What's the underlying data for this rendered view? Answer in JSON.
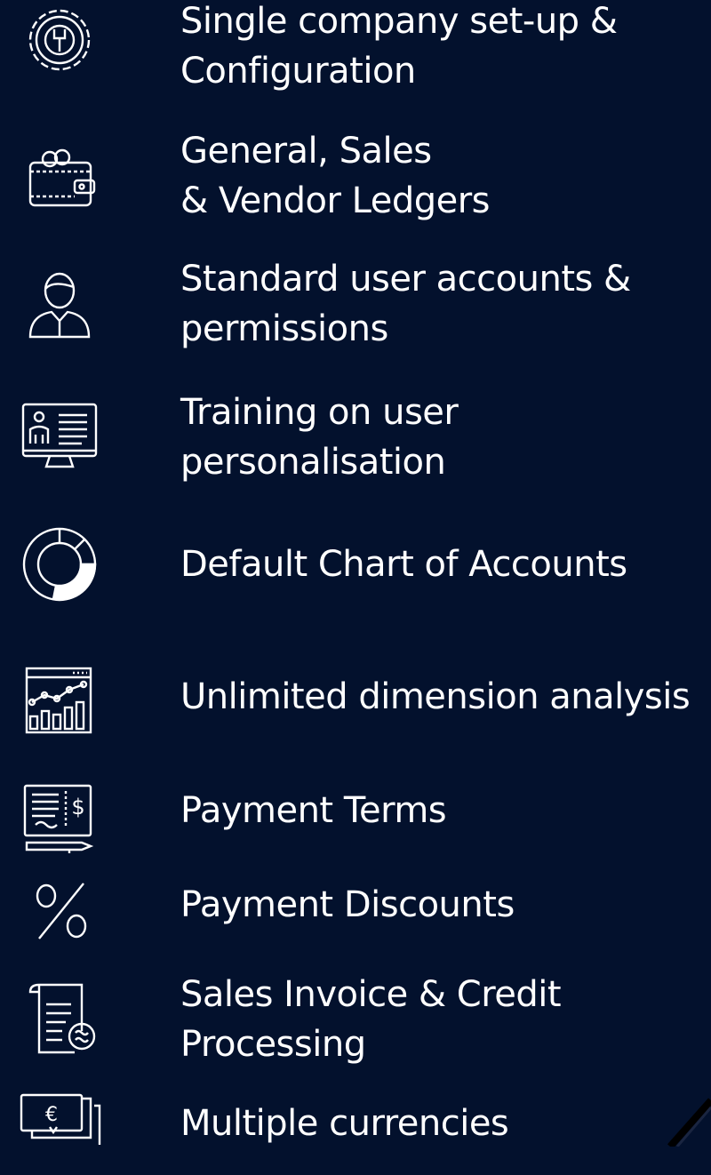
{
  "colors": {
    "background": "#03112d",
    "foreground": "#ffffff"
  },
  "features": [
    {
      "icon": "gear-wrench-icon",
      "lines": [
        "Single company set-up &",
        "Configuration"
      ]
    },
    {
      "icon": "wallet-icon",
      "lines": [
        "General, Sales",
        "& Vendor Ledgers"
      ]
    },
    {
      "icon": "user-icon",
      "lines": [
        "Standard user accounts &",
        "permissions"
      ]
    },
    {
      "icon": "monitor-training-icon",
      "lines": [
        "Training on user",
        "personalisation"
      ]
    },
    {
      "icon": "donut-chart-icon",
      "lines": [
        "Default Chart of Accounts"
      ]
    },
    {
      "icon": "analytics-chart-icon",
      "lines": [
        "Unlimited dimension analysis"
      ]
    },
    {
      "icon": "cheque-pen-icon",
      "lines": [
        "Payment Terms"
      ]
    },
    {
      "icon": "percent-icon",
      "lines": [
        "Payment Discounts"
      ]
    },
    {
      "icon": "invoice-scroll-icon",
      "lines": [
        "Sales Invoice & Credit",
        "Processing"
      ]
    },
    {
      "icon": "euro-banknote-icon",
      "lines": [
        "Multiple currencies"
      ]
    }
  ]
}
